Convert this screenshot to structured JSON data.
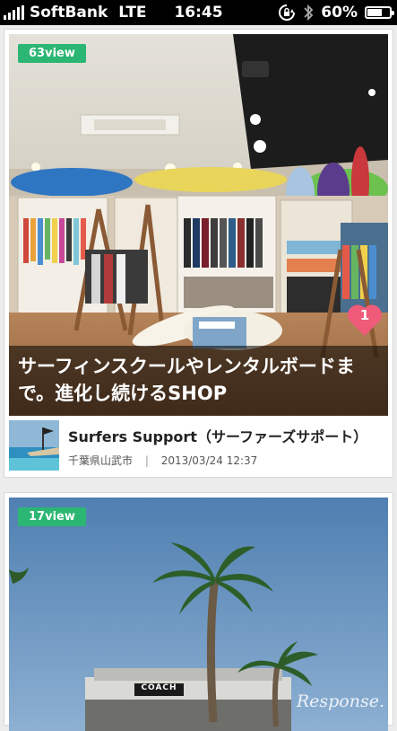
{
  "status_bar": {
    "carrier": "SoftBank",
    "network": "LTE",
    "time": "16:45",
    "battery": "60%",
    "icons": [
      "signal-bars-icon",
      "rotation-lock-icon",
      "bluetooth-icon",
      "battery-icon"
    ]
  },
  "feed": [
    {
      "view_badge": "63view",
      "headline": "サーフィンスクールやレンタルボードまで。進化し続けるSHOP",
      "likes": "1",
      "shop_name": "Surfers Support（サーファーズサポート）",
      "location": "千葉県山武市",
      "separator": "|",
      "date": "2013/03/24 12:37"
    },
    {
      "view_badge": "17view",
      "store_sign": "COACH"
    }
  ],
  "watermark": "Response.",
  "colors": {
    "badge": "#2bb673",
    "heart": "#ef5b79",
    "status_bar": "#000000"
  }
}
